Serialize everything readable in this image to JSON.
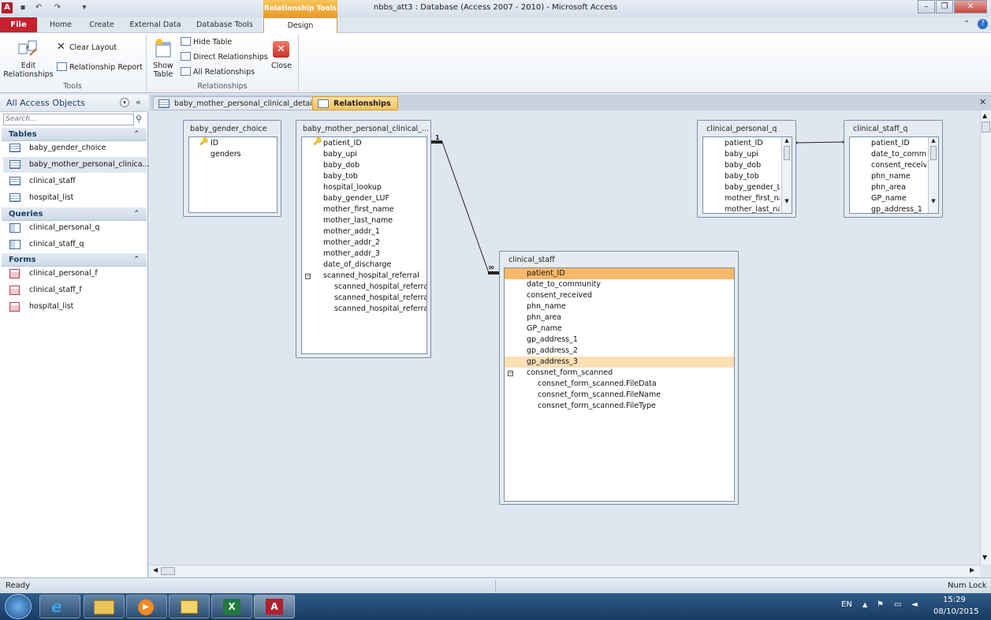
{
  "window": {
    "title": "nbbs_att3 : Database (Access 2007 - 2010)  -  Microsoft Access",
    "context_tab": "Relationship Tools",
    "app_icon": "A"
  },
  "ribbon_tabs": [
    "File",
    "Home",
    "Create",
    "External Data",
    "Database Tools",
    "Design"
  ],
  "ribbon": {
    "edit_relationships": "Edit\nRelationships",
    "clear_layout": "Clear Layout",
    "relationship_report": "Relationship Report",
    "show_table": "Show\nTable",
    "hide_table": "Hide Table",
    "direct_relationships": "Direct Relationships",
    "all_relationships": "All Relationships",
    "close": "Close",
    "group_tools": "Tools",
    "group_relationships": "Relationships"
  },
  "nav": {
    "header": "All Access Objects",
    "search_placeholder": "Search...",
    "tables_header": "Tables",
    "tables": [
      "baby_gender_choice",
      "baby_mother_personal_clinica...",
      "clinical_staff",
      "hospital_list"
    ],
    "queries_header": "Queries",
    "queries": [
      "clinical_personal_q",
      "clinical_staff_q"
    ],
    "forms_header": "Forms",
    "forms": [
      "clinical_personal_f",
      "clinical_staff_f",
      "hospital_list"
    ]
  },
  "doc_tabs": [
    "baby_mother_personal_clinical_details",
    "Relationships"
  ],
  "tables": {
    "gender": {
      "title": "baby_gender_choice",
      "fields": [
        "ID",
        "genders"
      ]
    },
    "mother": {
      "title": "baby_mother_personal_clinical_...",
      "fields": [
        "patient_ID",
        "baby_upi",
        "baby_dob",
        "baby_tob",
        "hospital_lookup",
        "baby_gender_LUF",
        "mother_first_name",
        "mother_last_name",
        "mother_addr_1",
        "mother_addr_2",
        "mother_addr_3",
        "date_of_discharge",
        "scanned_hospital_referral",
        "scanned_hospital_referral.",
        "scanned_hospital_referral.",
        "scanned_hospital_referral."
      ]
    },
    "staff": {
      "title": "clinical_staff",
      "fields": [
        "patient_ID",
        "date_to_community",
        "consent_received",
        "phn_name",
        "phn_area",
        "GP_name",
        "gp_address_1",
        "gp_address_2",
        "gp_address_3",
        "consnet_form_scanned",
        "consnet_form_scanned.FileData",
        "consnet_form_scanned.FileName",
        "consnet_form_scanned.FileType"
      ]
    },
    "personal_q": {
      "title": "clinical_personal_q",
      "fields": [
        "patient_ID",
        "baby_upi",
        "baby_dob",
        "baby_tob",
        "baby_gender_LU",
        "mother_first_na",
        "mother_last_nar"
      ]
    },
    "staff_q": {
      "title": "clinical_staff_q",
      "fields": [
        "patient_ID",
        "date_to_commu",
        "consent_receive",
        "phn_name",
        "phn_area",
        "GP_name",
        "gp_address_1"
      ]
    }
  },
  "relationship": {
    "one_label": "1",
    "many_label": "∞"
  },
  "status": {
    "left": "Ready",
    "right": "Num Lock"
  },
  "taskbar": {
    "lang": "EN",
    "time": "15:29",
    "date": "08/10/2015"
  }
}
